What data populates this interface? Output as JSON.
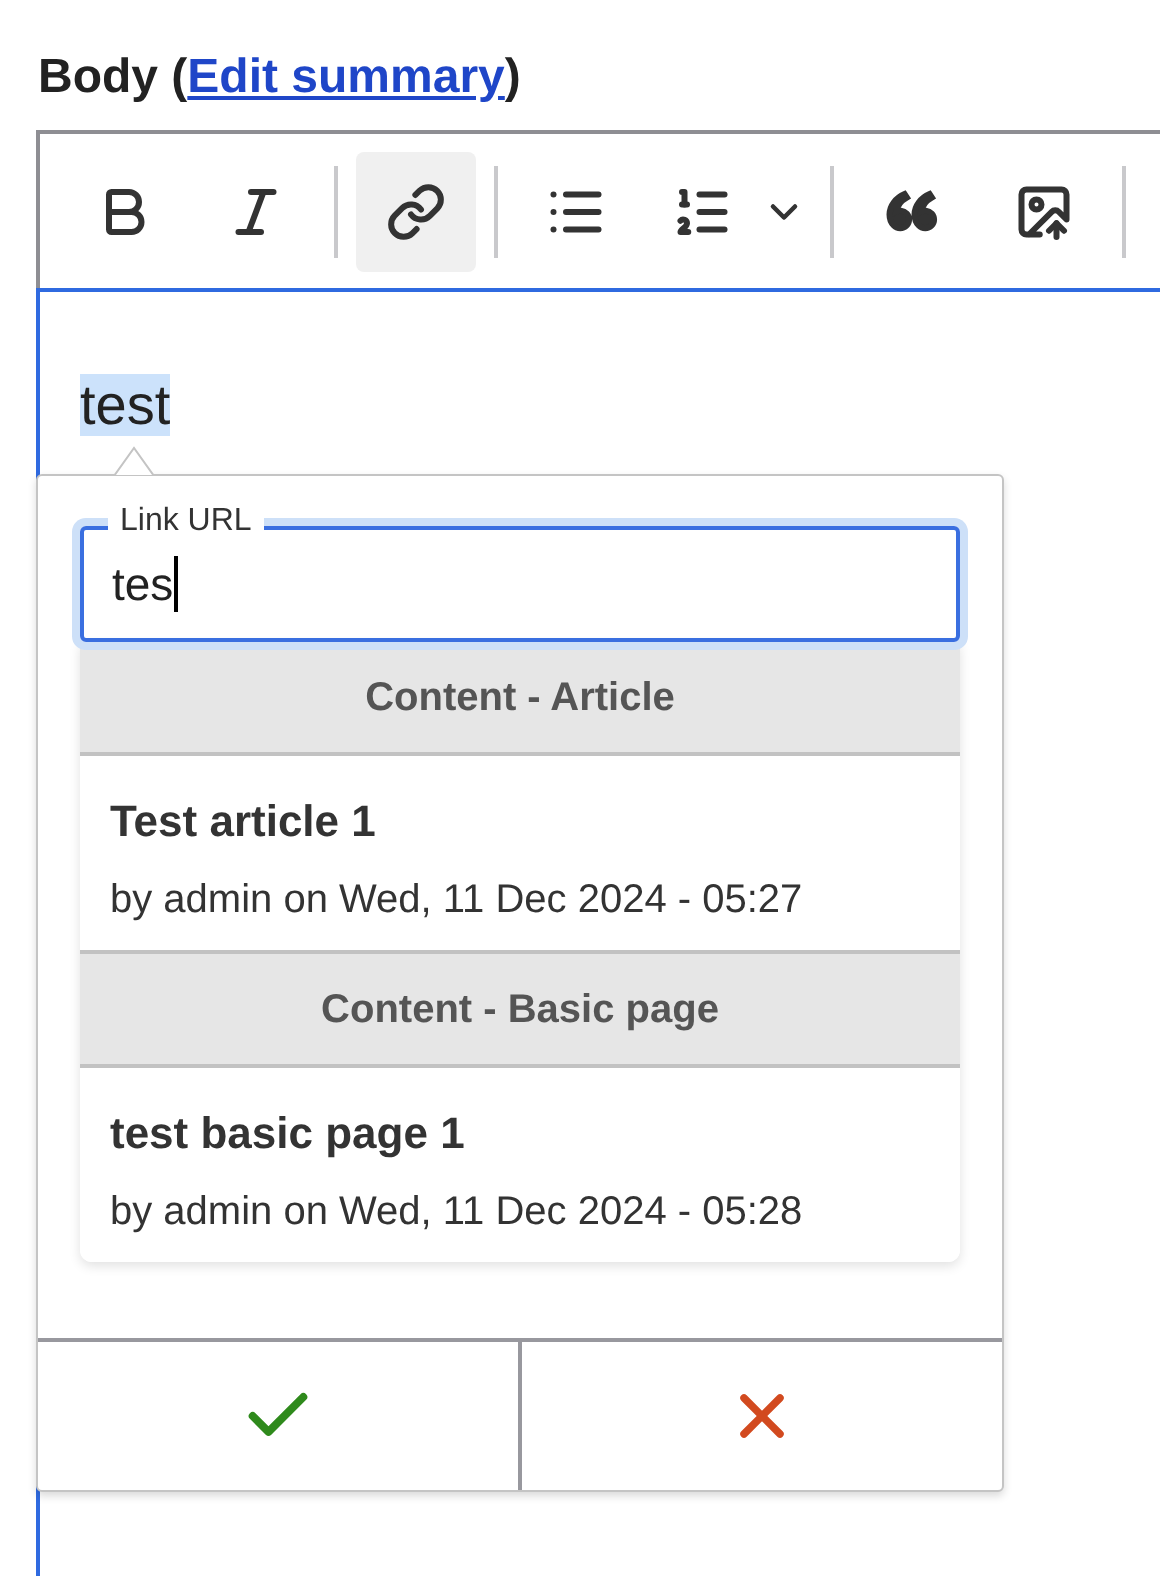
{
  "field": {
    "prefix": "Body (",
    "link": "Edit summary",
    "suffix": ")"
  },
  "toolbar": [
    [
      {
        "kind": "button",
        "selected": false
      },
      {
        "kind": "button",
        "selected": false
      }
    ],
    [
      {
        "kind": "button",
        "selected": true
      }
    ],
    [
      {
        "kind": "button",
        "selected": false
      },
      {
        "kind": "split",
        "selected": false
      }
    ],
    [
      {
        "kind": "button",
        "selected": false
      },
      {
        "kind": "button",
        "selected": false
      }
    ]
  ],
  "editor": {
    "text": "test",
    "selected": true
  },
  "link_balloon": {
    "label": "Link URL",
    "value": "tes",
    "groups": [
      {
        "heading": "Content - Article",
        "items": [
          {
            "title": "Test article 1",
            "meta": "by admin on Wed, 11 Dec 2024 - 05:27"
          }
        ]
      },
      {
        "heading": "Content - Basic page",
        "items": [
          {
            "title": "test basic page 1",
            "meta": "by admin on Wed, 11 Dec 2024 - 05:28"
          }
        ]
      }
    ],
    "actions": [
      {
        "kind": "save"
      },
      {
        "kind": "cancel"
      }
    ]
  }
}
